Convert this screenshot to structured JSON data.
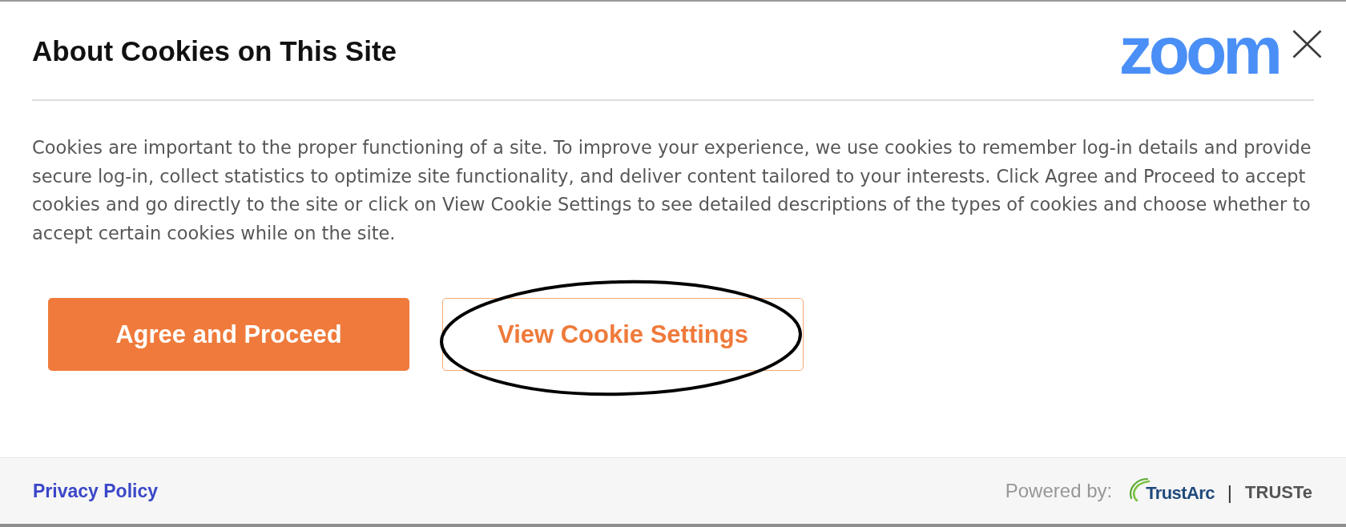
{
  "dialog": {
    "title": "About Cookies on This Site",
    "logo": "zoom",
    "body": "Cookies are important to the proper functioning of a site. To improve your experience, we use cookies to remember log-in details and provide secure log-in, collect statistics to optimize site functionality, and deliver content tailored to your interests. Click Agree and Proceed to accept cookies and go directly to the site or click on View Cookie Settings to see detailed descriptions of the types of cookies and choose whether to accept certain cookies while on the site.",
    "buttons": [
      {
        "label": "Agree and Proceed",
        "kind": "primary",
        "circled": false
      },
      {
        "label": "View Cookie Settings",
        "kind": "secondary",
        "circled": true
      }
    ]
  },
  "footer": {
    "link": "Privacy Policy",
    "powered_by": {
      "label": "Powered by:",
      "separator": "|",
      "brands": [
        {
          "name": "TrustArc",
          "kind": "trustarc"
        },
        {
          "name": "TRUSTe",
          "kind": "truste"
        }
      ]
    }
  }
}
